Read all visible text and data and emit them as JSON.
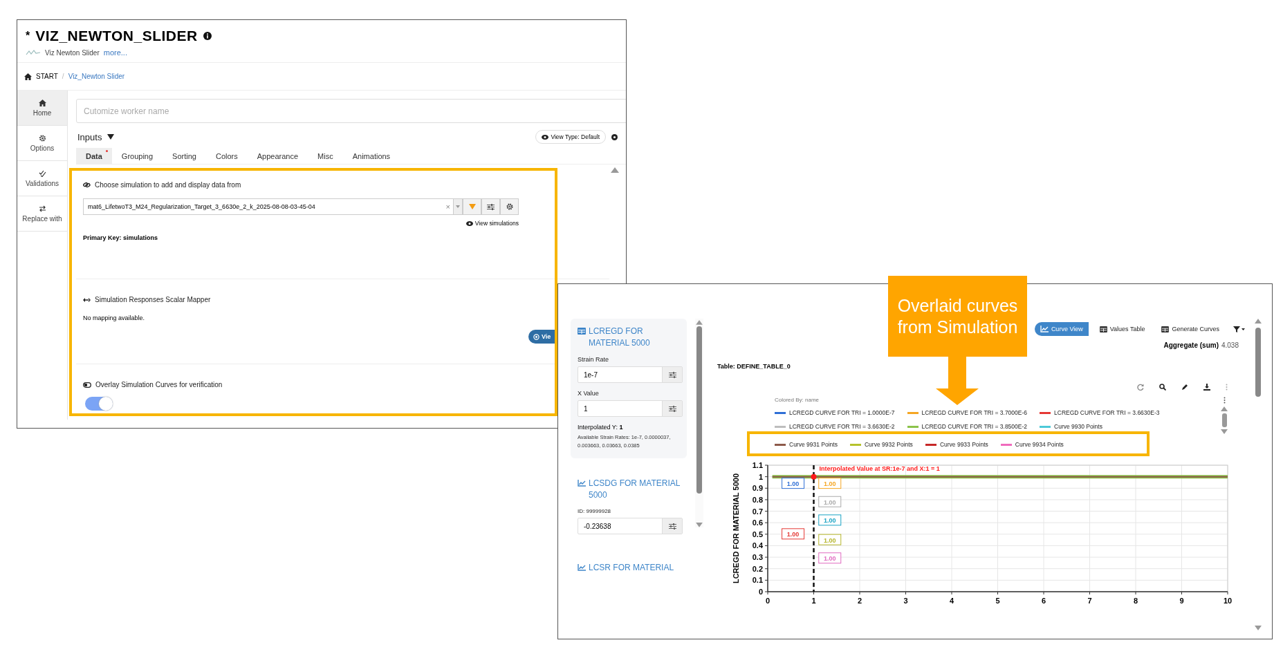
{
  "editor_window": {
    "modified_mark": "*",
    "title": "VIZ_NEWTON_SLIDER",
    "subtitle": "Viz Newton Slider",
    "more_link": "more...",
    "breadcrumb": [
      "START",
      "Viz_Newton Slider"
    ],
    "breadcrumb_separator": "/",
    "nav": [
      {
        "label": "Home",
        "selected": true
      },
      {
        "label": "Options",
        "selected": false
      },
      {
        "label": "Validations",
        "selected": false
      },
      {
        "label": "Replace with",
        "selected": false
      }
    ],
    "worker_name": {
      "placeholder": "Cutomize worker name"
    },
    "inputs_label": "Inputs",
    "view_type_button": "View Type: Default",
    "tabs": [
      {
        "label": "Data",
        "selected": true,
        "required": true
      },
      {
        "label": "Grouping",
        "selected": false,
        "required": false
      },
      {
        "label": "Sorting",
        "selected": false,
        "required": false
      },
      {
        "label": "Colors",
        "selected": false,
        "required": false
      },
      {
        "label": "Appearance",
        "selected": false,
        "required": false
      },
      {
        "label": "Misc",
        "selected": false,
        "required": false
      },
      {
        "label": "Animations",
        "selected": false,
        "required": false
      }
    ],
    "simulation": {
      "heading": "Choose simulation to add and display data from",
      "value": "mat6_LifetwoT3_M24_Regularization_Target_3_6630e_2_k_2025-08-08-03-45-04",
      "clear_button": "×",
      "view_link": "View simulations",
      "primary_key": "Primary Key: simulations"
    },
    "mapper": {
      "heading": "Simulation Responses Scalar Mapper",
      "message": "No mapping available.",
      "button": "Vie"
    },
    "overlay": {
      "heading": "Overlay Simulation Curves for verification",
      "on": true
    }
  },
  "viewer_window": {
    "cards": [
      {
        "kind": "table",
        "title": "LCREGD FOR MATERIAL 5000",
        "fields": [
          {
            "label": "Strain Rate",
            "value": "1e-7"
          },
          {
            "label": "X Value",
            "value": "1"
          }
        ],
        "result": "Interpolated Y: **1**",
        "note": "Available Strain Rates: 1e-7, 0.0000037, 0.003663, 0.03663, 0.0385"
      },
      {
        "kind": "curve",
        "title": "LCSDG FOR MATERIAL 5000",
        "id": "ID: 99999928",
        "fields": [
          {
            "value": "-0.23638"
          }
        ]
      },
      {
        "kind": "curve",
        "title": "LCSR FOR MATERIAL"
      }
    ],
    "view_buttons": [
      {
        "label": "Curve View",
        "selected": true
      },
      {
        "label": "Values Table",
        "selected": false
      },
      {
        "label": "Generate Curves",
        "selected": false
      }
    ],
    "aggregate": {
      "label": "Aggregate (sum)",
      "value": "4.038"
    },
    "table_label": "Table: DEFINE_TABLE_0",
    "legend_title": "Colored By: name",
    "value_boxes": [
      {
        "text": "1.00",
        "color": "#2f6fd6"
      },
      {
        "text": "1.00",
        "color": "#f5a623"
      },
      {
        "text": "1.00",
        "color": "#aaaaaa"
      },
      {
        "text": "1.00",
        "color": "#1aa3c4"
      },
      {
        "text": "1.00",
        "color": "#e53935"
      },
      {
        "text": "1.00",
        "color": "#b5b52b"
      },
      {
        "text": "1.00",
        "color": "#e06bc0"
      }
    ],
    "chart_data": {
      "type": "line",
      "ylabel": "LCREGD FOR MATERIAL 5000",
      "x": [
        0.1,
        10
      ],
      "xlim": [
        0,
        10
      ],
      "ylim": [
        0,
        1.1
      ],
      "grid": true,
      "xticks": [
        0,
        1,
        2,
        3,
        4,
        5,
        6,
        7,
        8,
        9,
        10
      ],
      "yticks": [
        0,
        0.1,
        0.2,
        0.3,
        0.4,
        0.5,
        0.6,
        0.7,
        0.8,
        0.9,
        1,
        1.1
      ],
      "series": [
        {
          "name": "LCREGD CURVE FOR TRI = 1.0000E-7",
          "color": "#2f6fd6",
          "values": [
            null,
            null
          ]
        },
        {
          "name": "LCREGD CURVE FOR TRI = 3.7000E-6",
          "color": "#f5a623",
          "values": [
            null,
            null
          ]
        },
        {
          "name": "LCREGD CURVE FOR TRI = 3.6630E-3",
          "color": "#e53935",
          "values": [
            null,
            null
          ]
        },
        {
          "name": "LCREGD CURVE FOR TRI = 3.6630E-2",
          "color": "#bdbdbd",
          "values": [
            null,
            null
          ]
        },
        {
          "name": "LCREGD CURVE FOR TRI = 3.8500E-2",
          "color": "#8bc34a",
          "values": [
            1,
            1
          ]
        },
        {
          "name": "Curve 9930 Points",
          "color": "#4dc9d8",
          "values": [
            null,
            null
          ]
        },
        {
          "name": "Curve 9931 Points",
          "color": "#8d5a4a",
          "values": [
            1,
            1
          ]
        },
        {
          "name": "Curve 9932 Points",
          "color": "#b5c22b",
          "values": [
            null,
            null
          ]
        },
        {
          "name": "Curve 9933 Points",
          "color": "#c62828",
          "values": [
            null,
            null
          ]
        },
        {
          "name": "Curve 9934 Points",
          "color": "#f06bbd",
          "values": [
            null,
            null
          ]
        }
      ],
      "ref_lines": [
        {
          "axis": "x",
          "value": 1
        }
      ],
      "annotations": [
        {
          "text": "Interpolated Value at SR:1e-7 and X:1 = 1",
          "x": 1,
          "y": 1
        }
      ]
    }
  },
  "callout": {
    "text": "Overlaid curves from Simulation"
  }
}
